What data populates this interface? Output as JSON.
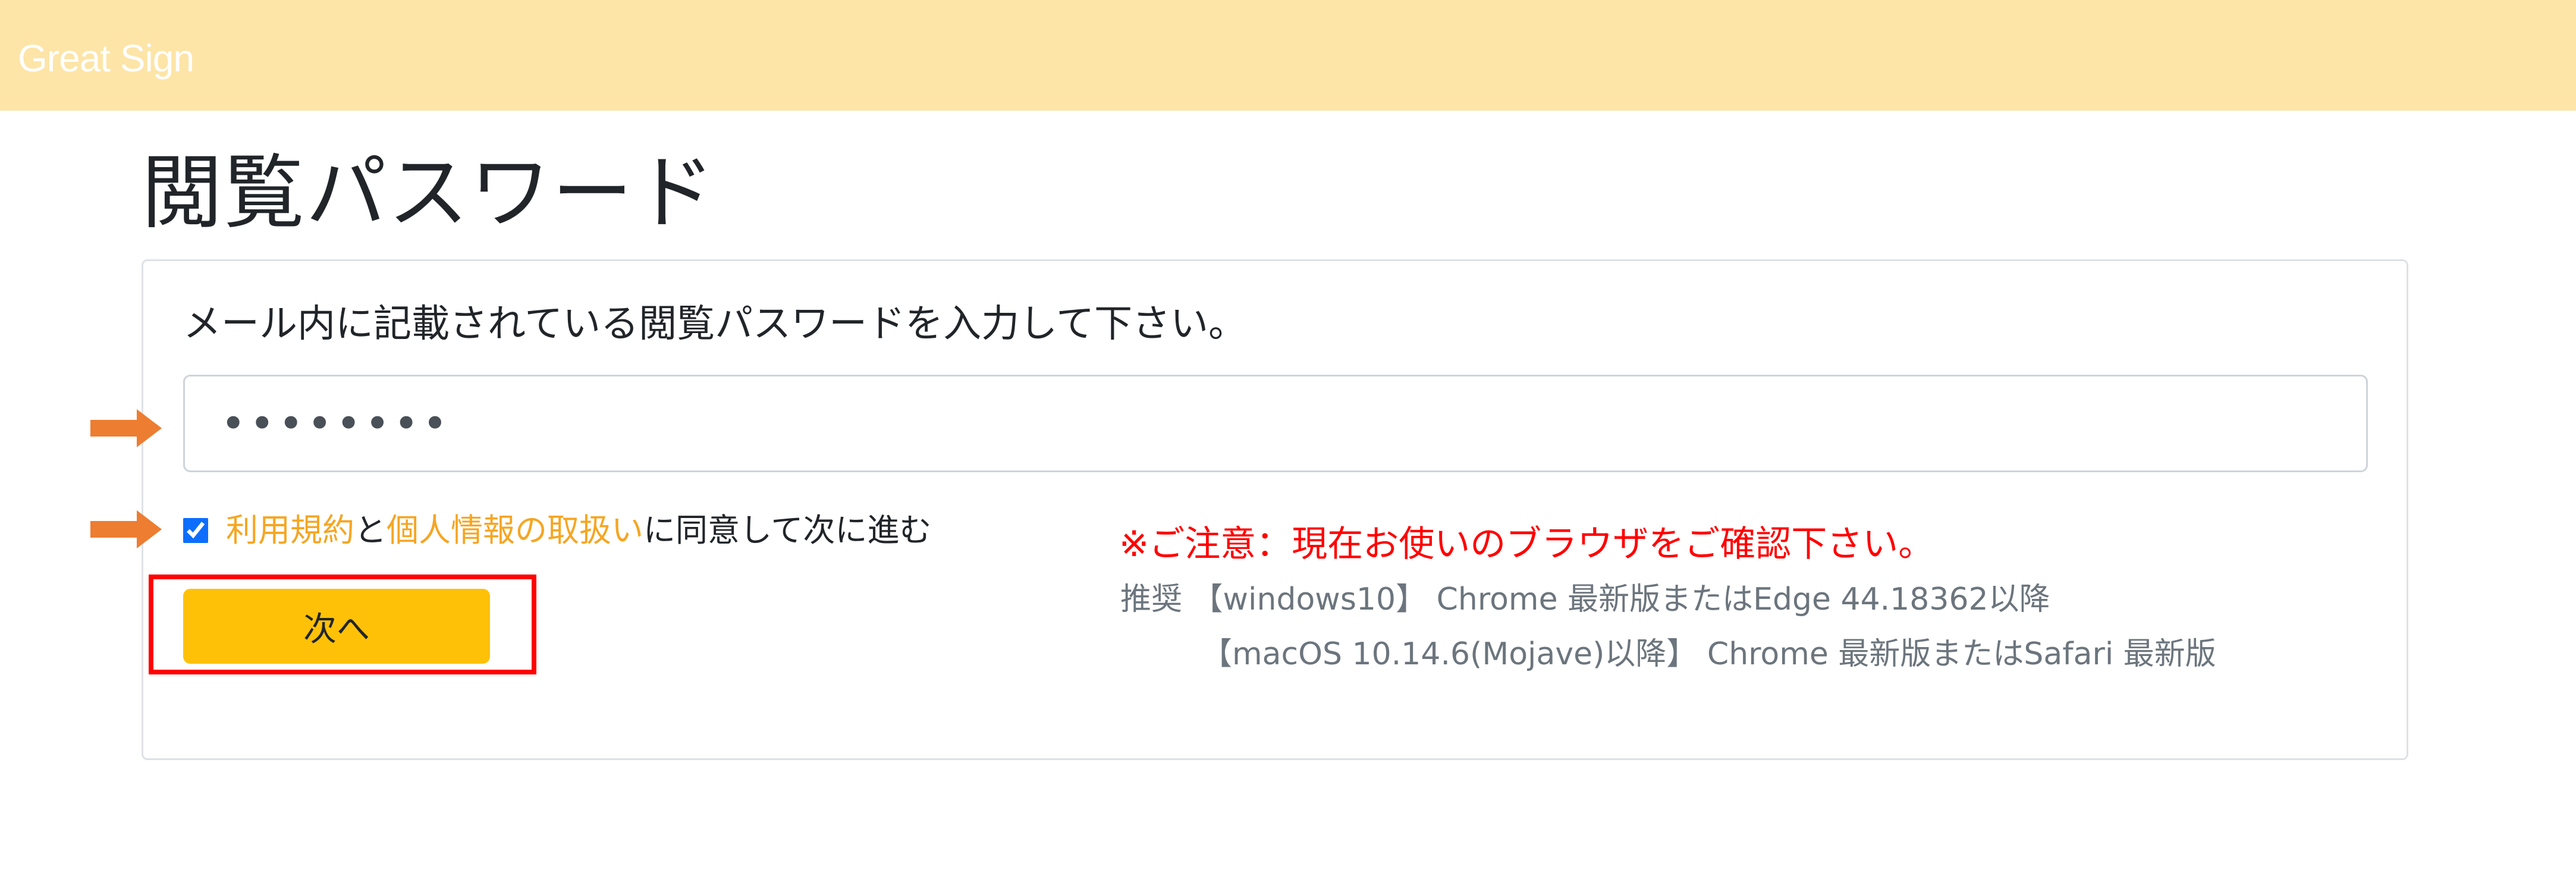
{
  "header": {
    "logo_text": "Great Sign",
    "background_color": "#fde5a8"
  },
  "page": {
    "title": "閲覧パスワード"
  },
  "form": {
    "instruction": "メール内に記載されている閲覧パスワードを入力して下さい。",
    "password_value": "••••••••",
    "agree": {
      "checked": true,
      "terms_link": "利用規約",
      "connector": "と",
      "privacy_link": "個人情報の取扱い",
      "suffix": "に同意して次に進む"
    },
    "next_button_label": "次へ"
  },
  "notice": {
    "title": "※ご注意：現在お使いのブラウザをご確認下さい。",
    "line1": "推奨 【windows10】 Chrome 最新版またはEdge 44.18362以降",
    "line2": "【macOS 10.14.6(Mojave)以降】 Chrome 最新版またはSafari 最新版"
  },
  "annotations": {
    "arrow_color": "#ed7d31",
    "highlight_color": "#ff0000"
  }
}
